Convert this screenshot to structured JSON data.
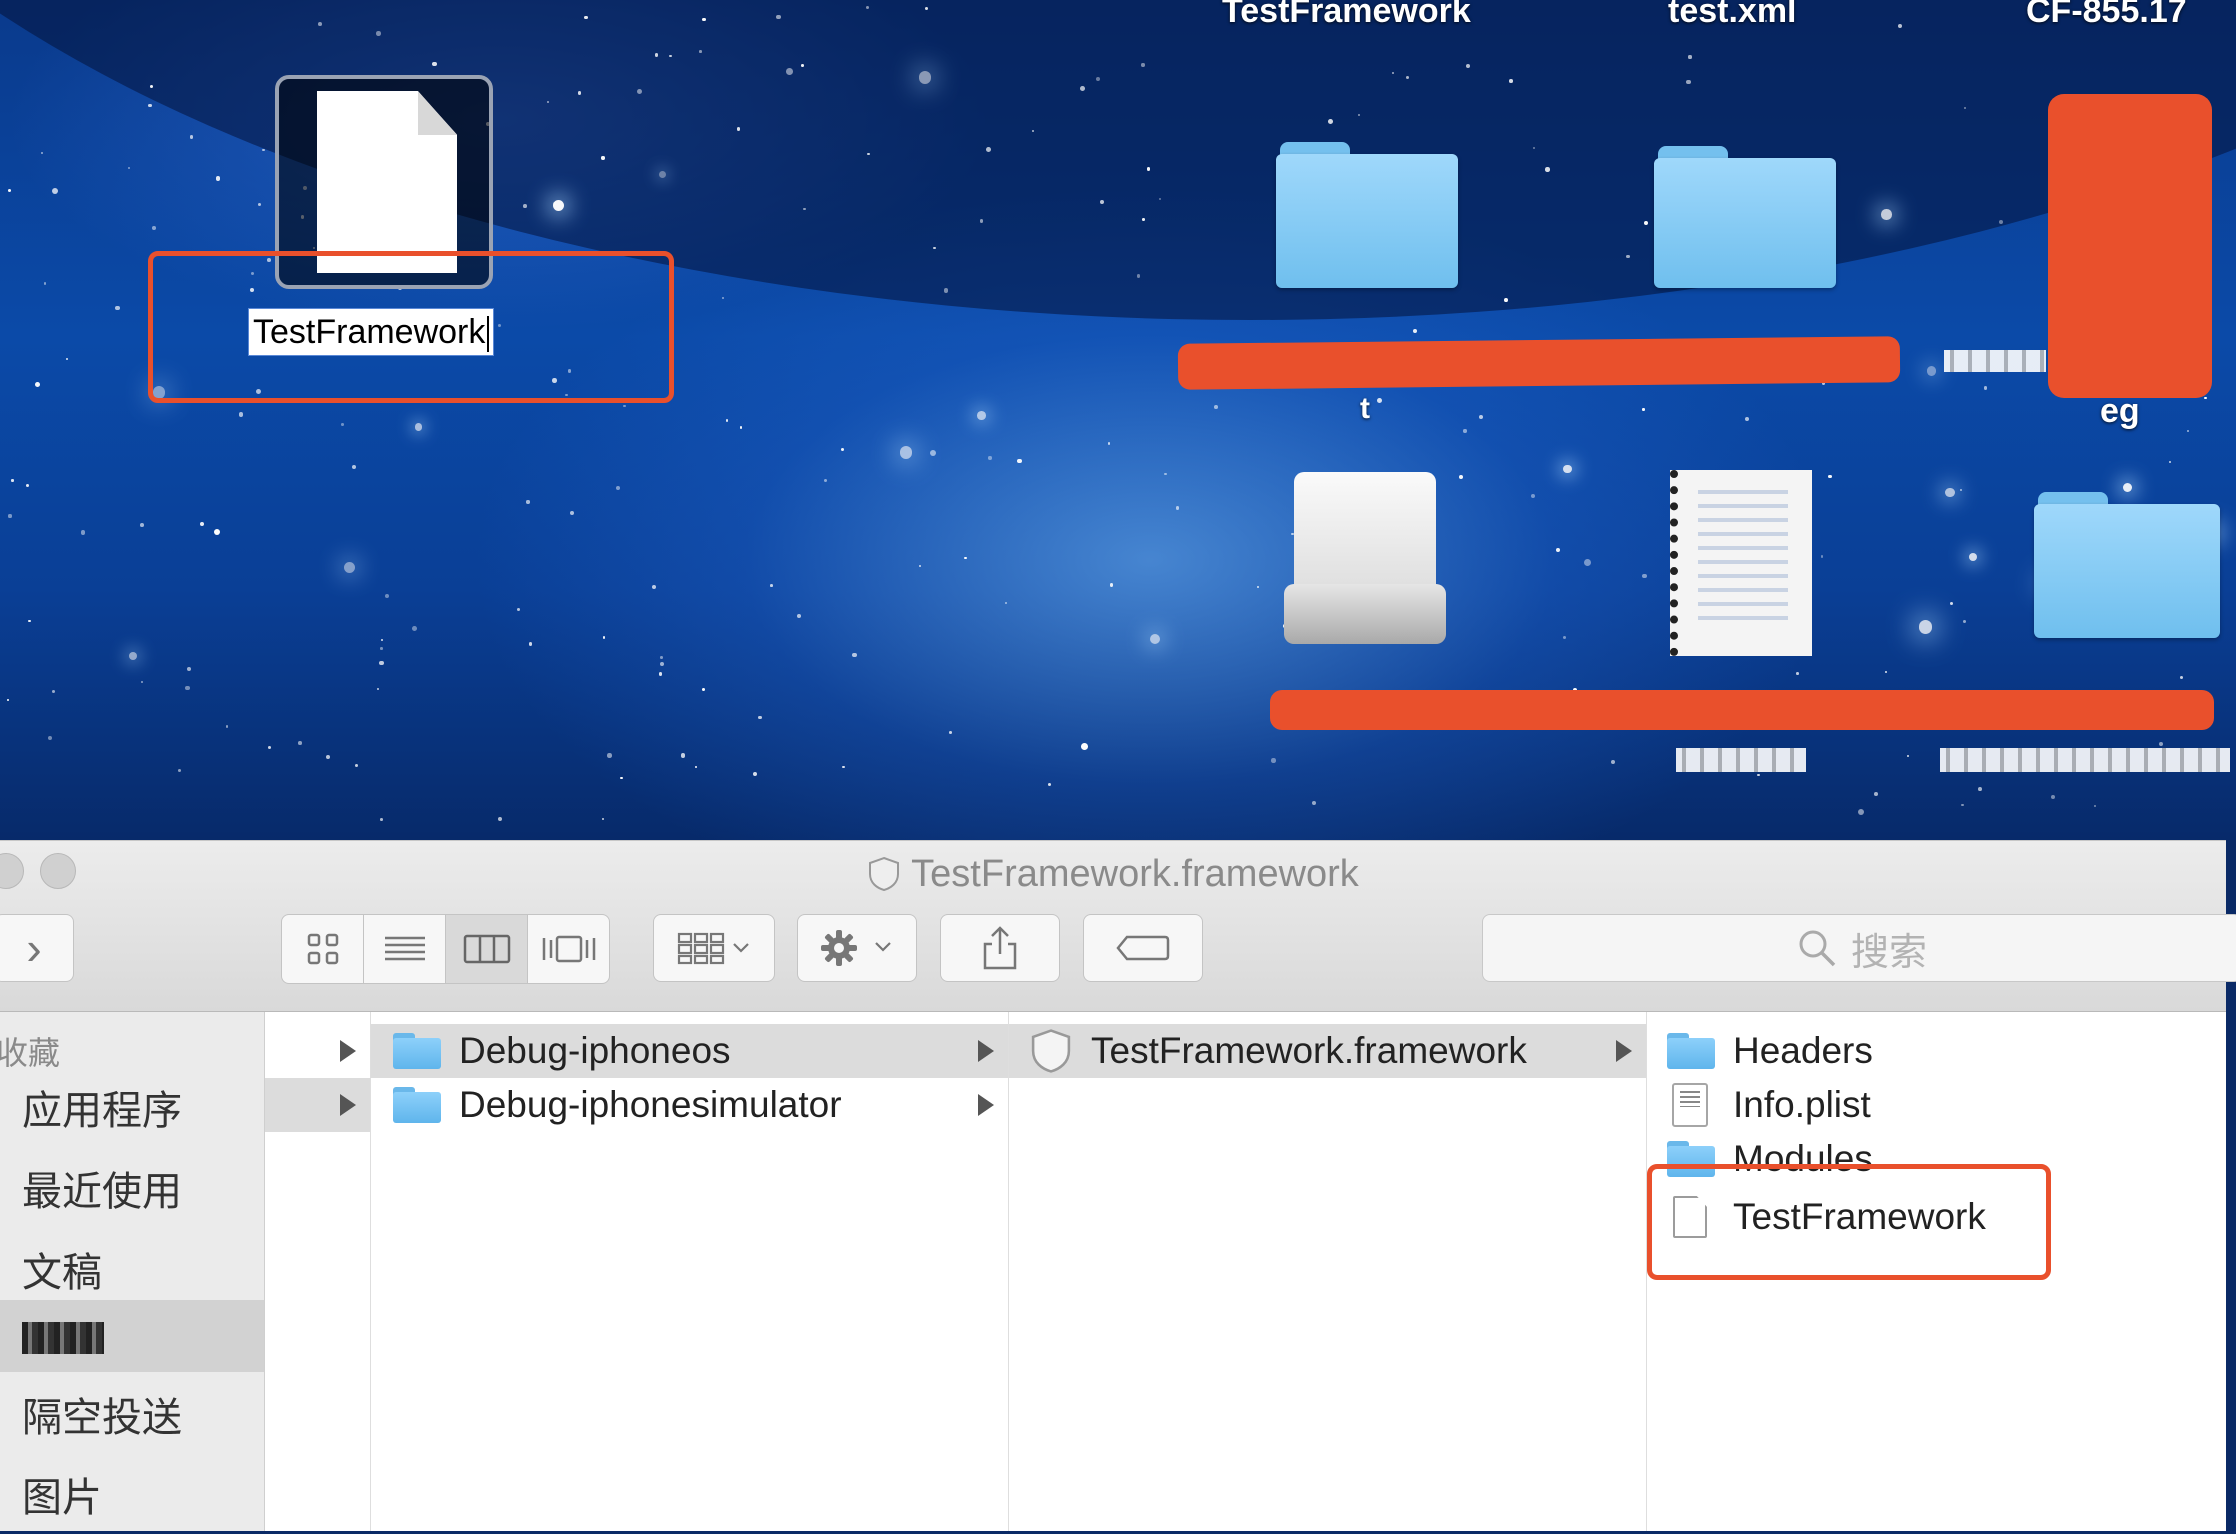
{
  "desktop": {
    "top_labels": [
      "TestFramework",
      "test.xml",
      "CF-855.17"
    ],
    "selected_file": {
      "rename_value": "TestFramework"
    },
    "other_labels": {
      "eg": "eg"
    }
  },
  "finder": {
    "title": "TestFramework.framework",
    "toolbar": {
      "forward_glyph": "›",
      "search_placeholder": "搜索"
    },
    "sidebar": {
      "header": "收藏",
      "items": [
        "应用程序",
        "最近使用",
        "文稿",
        "",
        "隔空投送",
        "图片"
      ]
    },
    "columns": {
      "col2": [
        {
          "name": "Debug-iphoneos",
          "selected": true
        },
        {
          "name": "Debug-iphonesimulator",
          "selected": false
        }
      ],
      "col3": [
        {
          "name": "TestFramework.framework",
          "selected": true
        }
      ],
      "col4": [
        {
          "name": "Headers",
          "kind": "folder"
        },
        {
          "name": "Info.plist",
          "kind": "plist"
        },
        {
          "name": "Modules",
          "kind": "folder"
        },
        {
          "name": "TestFramework",
          "kind": "document"
        }
      ]
    }
  },
  "colors": {
    "annotation_red": "#e9502c",
    "folder_blue": "#6fbfee",
    "selection_gray": "#dcdcdc"
  }
}
